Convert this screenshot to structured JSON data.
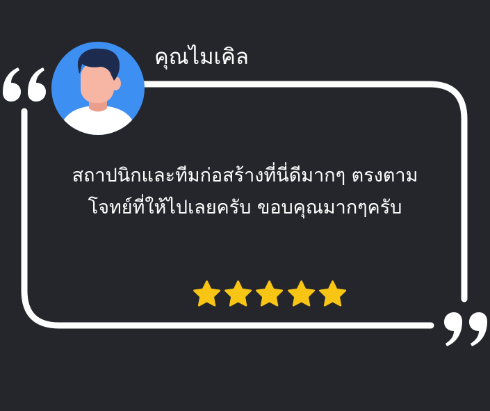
{
  "reviewer": {
    "name": "คุณไมเคิล"
  },
  "review": {
    "line1": "สถาปนิกและทีมก่อสร้างที่นี่ดีมากๆ ตรงตาม",
    "line2": "โจทย์ที่ให้ไปเลยครับ ขอบคุณมากๆครับ"
  },
  "rating": {
    "stars": 5,
    "max": 5
  },
  "colors": {
    "background": "#24262b",
    "frame": "#ffffff",
    "star": "#f9c515",
    "avatar_bg": "#3d8ff2",
    "hair": "#1d2b4f",
    "skin": "#f6b6a3",
    "shirt": "#ffffff"
  },
  "icons": [
    "open-quote-icon",
    "close-quote-icon",
    "avatar-icon",
    "star-icon"
  ]
}
